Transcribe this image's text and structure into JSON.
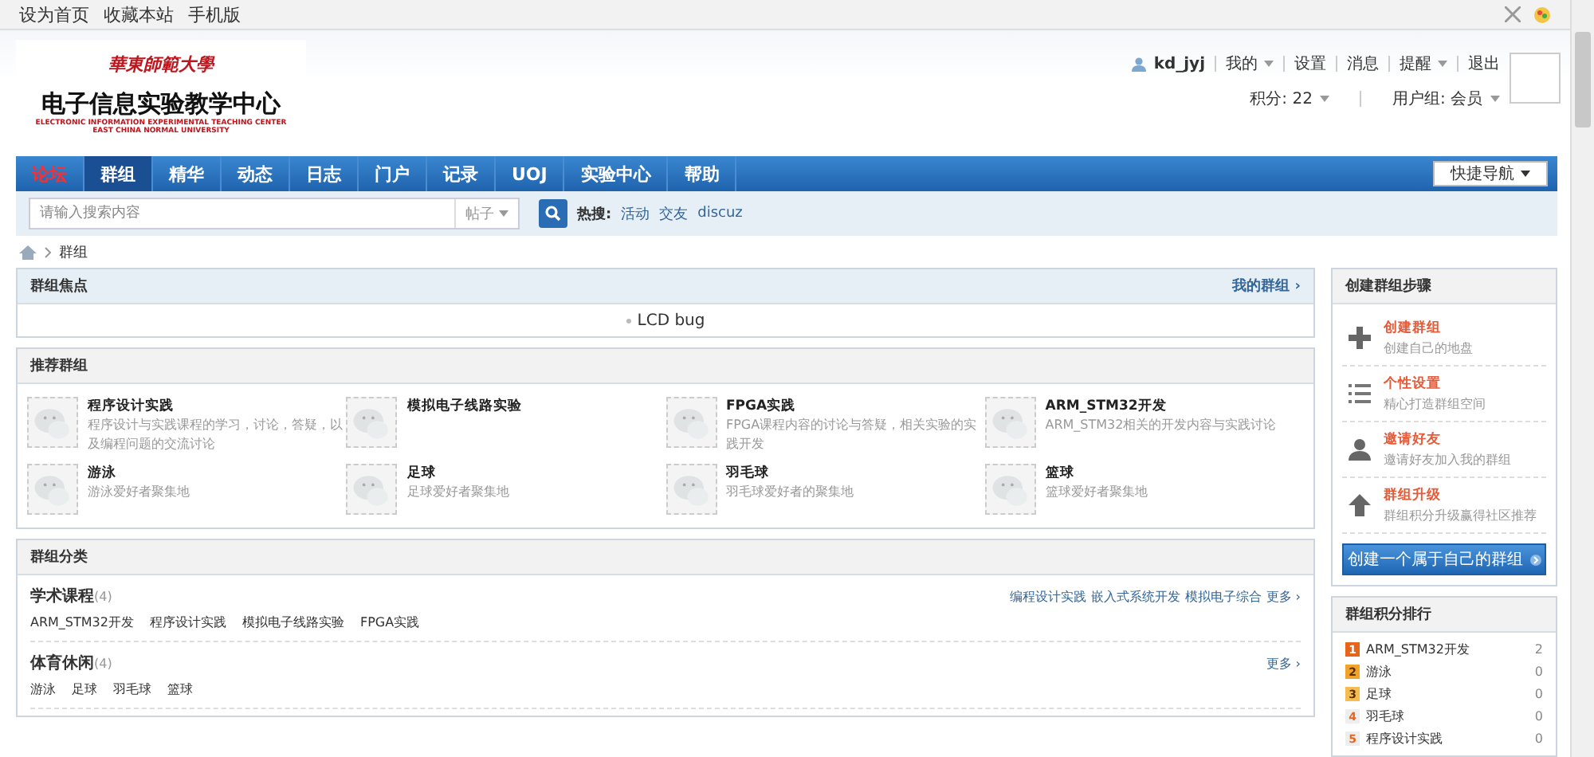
{
  "top_links": [
    "设为首页",
    "收藏本站",
    "手机版"
  ],
  "logo": {
    "school": "華東師範大學",
    "title": "电子信息实验教学中心",
    "subtitle_en": "ELECTRONIC INFORMATION EXPERIMENTAL TEACHING CENTER",
    "school_en": "EAST CHINA NORMAL UNIVERSITY"
  },
  "user": {
    "name": "kd_jyj",
    "links": [
      {
        "label": "我的",
        "dropdown": true
      },
      {
        "label": "设置",
        "dropdown": false
      },
      {
        "label": "消息",
        "dropdown": false
      },
      {
        "label": "提醒",
        "dropdown": true
      },
      {
        "label": "退出",
        "dropdown": false
      }
    ],
    "points": "积分: 22",
    "group": "用户组: 会员"
  },
  "nav": {
    "items": [
      {
        "label": "论坛",
        "selected": false,
        "highlight": true
      },
      {
        "label": "群组",
        "selected": true,
        "highlight": false
      },
      {
        "label": "精华",
        "selected": false,
        "highlight": false
      },
      {
        "label": "动态",
        "selected": false,
        "highlight": false
      },
      {
        "label": "日志",
        "selected": false,
        "highlight": false
      },
      {
        "label": "门户",
        "selected": false,
        "highlight": false
      },
      {
        "label": "记录",
        "selected": false,
        "highlight": false
      },
      {
        "label": "UOJ",
        "selected": false,
        "highlight": false
      },
      {
        "label": "实验中心",
        "selected": false,
        "highlight": false
      },
      {
        "label": "帮助",
        "selected": false,
        "highlight": false
      }
    ],
    "quick_nav": "快捷导航"
  },
  "search": {
    "placeholder": "请输入搜索内容",
    "scope": "帖子",
    "hot_label": "热搜:",
    "hot": [
      "活动",
      "交友",
      "discuz"
    ]
  },
  "breadcrumb": [
    "群组"
  ],
  "focus": {
    "title": "群组焦点",
    "link": "我的群组 ›",
    "items": [
      "LCD bug"
    ]
  },
  "recommend": {
    "title": "推荐群组",
    "groups": [
      {
        "name": "程序设计实践",
        "desc": "程序设计与实践课程的学习，讨论，答疑，以及编程问题的交流讨论"
      },
      {
        "name": "模拟电子线路实验"
      },
      {
        "name": "FPGA实践",
        "desc": "FPGA课程内容的讨论与答疑，相关实验的实践开发"
      },
      {
        "name": "ARM_STM32开发",
        "desc": "ARM_STM32相关的开发内容与实践讨论"
      },
      {
        "name": "游泳",
        "desc": "游泳爱好者聚集地"
      },
      {
        "name": "足球",
        "desc": "足球爱好者聚集地"
      },
      {
        "name": "羽毛球",
        "desc": "羽毛球爱好者的聚集地"
      },
      {
        "name": "篮球",
        "desc": "篮球爱好者聚集地"
      }
    ]
  },
  "categories": {
    "title": "群组分类",
    "sections": [
      {
        "name": "学术课程",
        "count": "(4)",
        "groups": [
          "ARM_STM32开发",
          "程序设计实践",
          "模拟电子线路实验",
          "FPGA实践"
        ],
        "links": [
          "编程设计实践",
          "嵌入式系统开发",
          "模拟电子综合"
        ],
        "more": "更多 ›"
      },
      {
        "name": "体育休闲",
        "count": "(4)",
        "groups": [
          "游泳",
          "足球",
          "羽毛球",
          "篮球"
        ],
        "more": "更多 ›"
      }
    ]
  },
  "steps": {
    "title": "创建群组步骤",
    "items": [
      {
        "kind": "plus",
        "title": "创建群组",
        "desc": "创建自己的地盘"
      },
      {
        "kind": "list",
        "title": "个性设置",
        "desc": "精心打造群组空间"
      },
      {
        "kind": "person",
        "title": "邀请好友",
        "desc": "邀请好友加入我的群组"
      },
      {
        "kind": "up",
        "title": "群组升级",
        "desc": "群组积分升级赢得社区推荐"
      }
    ],
    "button": "创建一个属于自己的群组"
  },
  "ranking": {
    "title": "群组积分排行",
    "items": [
      {
        "rank": "1",
        "name": "ARM_STM32开发",
        "score": "2",
        "color": "#e8641b"
      },
      {
        "rank": "2",
        "name": "游泳",
        "score": "0",
        "color": "#f0a22a"
      },
      {
        "rank": "3",
        "name": "足球",
        "score": "0",
        "color": "#f5bd4f"
      },
      {
        "rank": "4",
        "name": "羽毛球",
        "score": "0",
        "color": "#eeeeee"
      },
      {
        "rank": "5",
        "name": "程序设计实践",
        "score": "0",
        "color": "#eeeeee"
      }
    ]
  }
}
